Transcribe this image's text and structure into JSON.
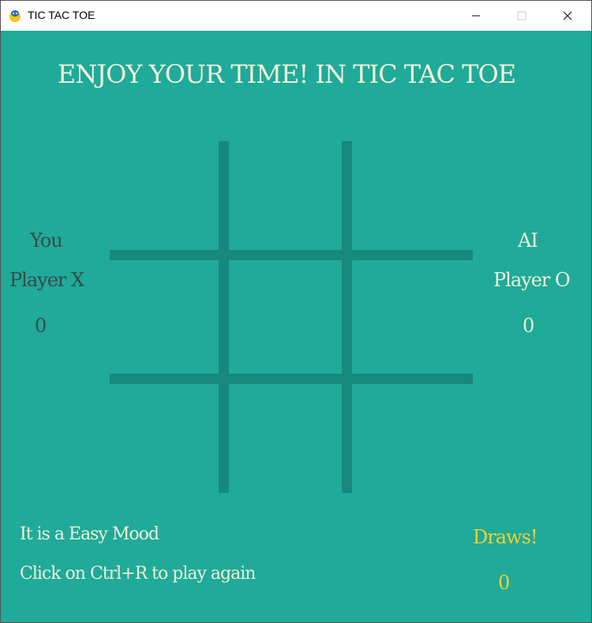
{
  "window": {
    "title": "TIC TAC TOE",
    "controls": [
      "minimize-icon",
      "maximize-icon",
      "close-icon"
    ]
  },
  "game": {
    "heading": "ENJOY YOUR TIME! IN TIC TAC TOE",
    "player_x": {
      "name": "You",
      "label": "Player X",
      "score": "0"
    },
    "player_o": {
      "name": "AI",
      "label": "Player O",
      "score": "0"
    },
    "draws": {
      "label": "Draws!",
      "score": "0"
    },
    "mode_text": "It is a Easy Mood",
    "restart_hint": "Click on Ctrl+R to play again",
    "board": {
      "cells": [
        "",
        "",
        "",
        "",
        "",
        "",
        "",
        "",
        ""
      ]
    }
  },
  "colors": {
    "background": "#1faa99",
    "grid": "#16897c",
    "player_x_text": "#3b4a48",
    "light_text": "#eef0d7",
    "draws_text": "#f2d22e"
  }
}
